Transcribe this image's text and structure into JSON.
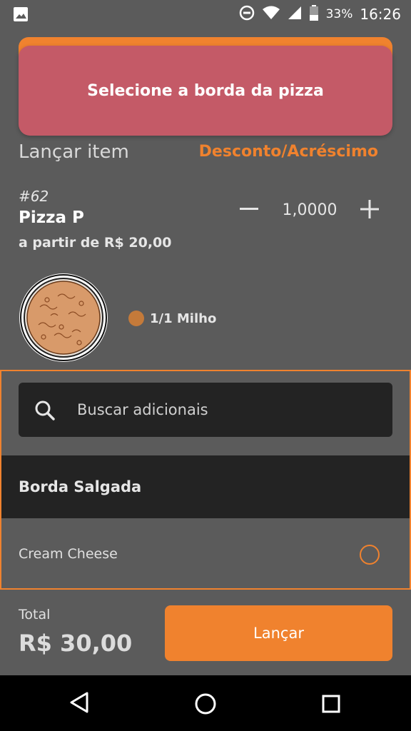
{
  "status_bar": {
    "battery_percent": "33%",
    "time": "16:26"
  },
  "toast": {
    "message": "Selecione a borda da pizza"
  },
  "header": {
    "title": "Lançar item",
    "discount_link": "Desconto/Acréscimo"
  },
  "item": {
    "code": "#62",
    "name": "Pizza P",
    "price_from": "a partir de R$ 20,00",
    "quantity": "1,0000"
  },
  "flavor": {
    "label": "1/1 Milho",
    "color": "#c47a3a"
  },
  "addons": {
    "search_placeholder": "Buscar adicionais",
    "group_title": "Borda Salgada",
    "options": [
      {
        "label": "Cream Cheese",
        "selected": false
      }
    ]
  },
  "footer": {
    "total_label": "Total",
    "total_value": "R$ 30,00",
    "launch_label": "Lançar"
  },
  "colors": {
    "accent": "#f0822e",
    "toast": "#c45a67",
    "background": "#5b5b5b"
  }
}
